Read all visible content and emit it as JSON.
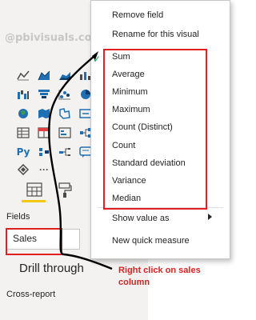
{
  "watermark": "@pbivisuals.com",
  "viz_icons": [
    "line-chart-icon",
    "area-chart-icon",
    "stacked-area-icon",
    "ribbon-chart-icon",
    "waterfall-icon",
    "funnel-icon",
    "scatter-chart-icon",
    "pie-chart-icon",
    "map-icon",
    "filled-map-icon",
    "shape-map-icon",
    "card-icon",
    "table-icon",
    "matrix-icon",
    "key-influencers-icon",
    "decomposition-tree-icon",
    "python-visual-icon",
    "r-script-icon",
    "smart-narrative-icon",
    "qna-icon",
    "more-visuals-icon"
  ],
  "viz_labels": {
    "python": "Py",
    "more": "···"
  },
  "pane_tabs": {
    "fields_tab_icon": "fields-tab-icon",
    "format_tab_icon": "format-paint-icon"
  },
  "fields_label": "Fields",
  "field_well_value": "Sales",
  "drill_through_heading": "Drill through",
  "cross_report_label": "Cross-report",
  "context_menu": {
    "top_items": [
      "Remove field",
      "Rename for this visual"
    ],
    "aggregations": [
      "Sum",
      "Average",
      "Minimum",
      "Maximum",
      "Count (Distinct)",
      "Count",
      "Standard deviation",
      "Variance",
      "Median"
    ],
    "selected_aggregation": "Sum",
    "bottom_items": [
      "Show value as",
      "New quick measure"
    ]
  },
  "annotation": {
    "line1": "Right click on sales",
    "line2": "column"
  },
  "colors": {
    "annotation": "#e02020",
    "check": "#1f9d55",
    "pane_bg": "#f3f2f1"
  }
}
